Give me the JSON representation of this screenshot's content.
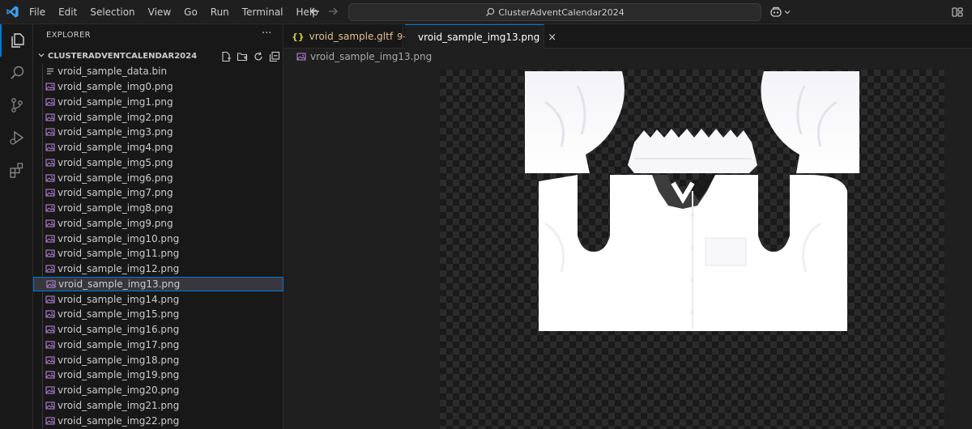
{
  "titlebar": {
    "menu": [
      "File",
      "Edit",
      "Selection",
      "View",
      "Go",
      "Run",
      "Terminal",
      "Help"
    ],
    "search_text": "ClusterAdventCalendar2024"
  },
  "sidebar": {
    "title": "EXPLORER",
    "more": "···",
    "folder_name": "CLUSTERADVENTCALENDAR2024",
    "files": [
      "vroid_sample_data.bin",
      "vroid_sample_img0.png",
      "vroid_sample_img1.png",
      "vroid_sample_img2.png",
      "vroid_sample_img3.png",
      "vroid_sample_img4.png",
      "vroid_sample_img5.png",
      "vroid_sample_img6.png",
      "vroid_sample_img7.png",
      "vroid_sample_img8.png",
      "vroid_sample_img9.png",
      "vroid_sample_img10.png",
      "vroid_sample_img11.png",
      "vroid_sample_img12.png",
      "vroid_sample_img13.png",
      "vroid_sample_img14.png",
      "vroid_sample_img15.png",
      "vroid_sample_img16.png",
      "vroid_sample_img17.png",
      "vroid_sample_img18.png",
      "vroid_sample_img19.png",
      "vroid_sample_img20.png",
      "vroid_sample_img21.png",
      "vroid_sample_img22.png"
    ],
    "selected_index": 14
  },
  "tabs": [
    {
      "label": "vroid_sample.gltf",
      "badge": "9+",
      "icon": "json-braces-icon"
    },
    {
      "label": "vroid_sample_img13.png",
      "icon": "image-file-icon",
      "close": "×"
    }
  ],
  "breadcrumb": {
    "label": "vroid_sample_img13.png"
  },
  "colors": {
    "accent": "#0078d4",
    "image_icon": "#b180d7",
    "modified": "#e2c08d"
  }
}
